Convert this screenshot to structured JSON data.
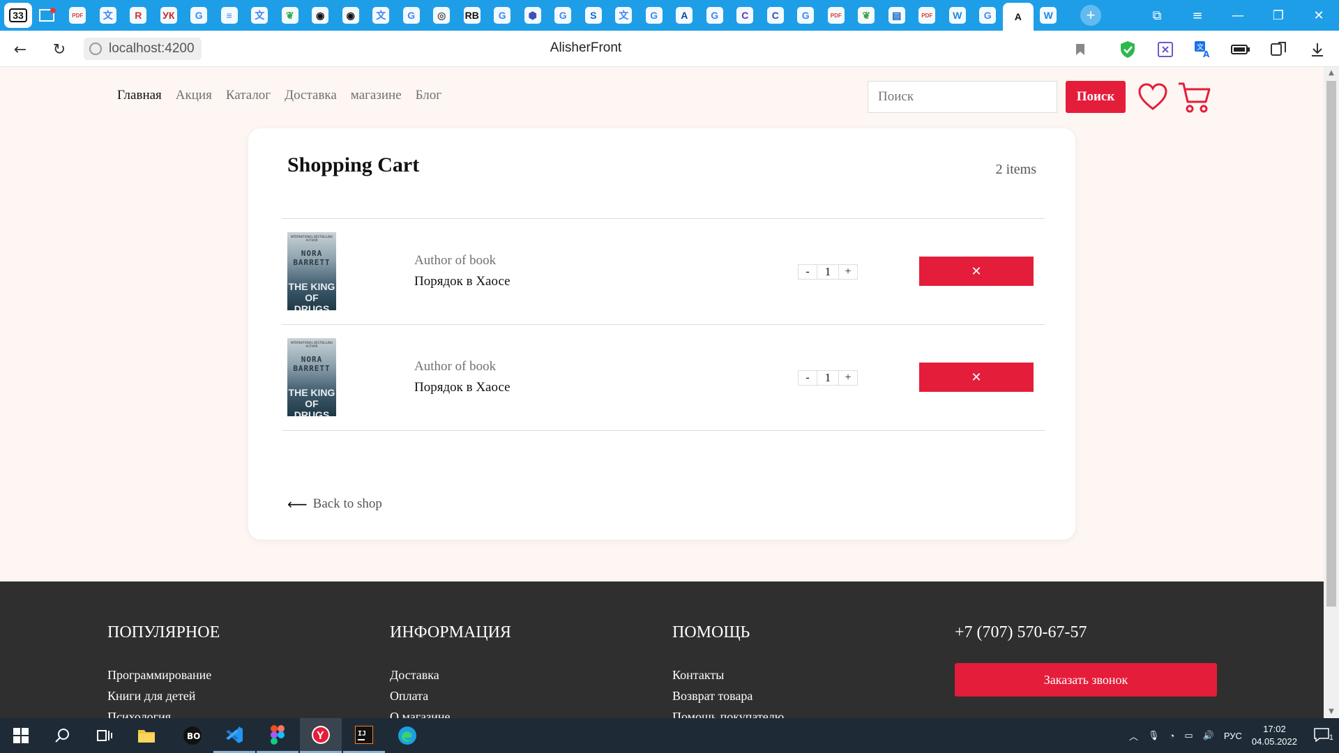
{
  "browser": {
    "tab_count": "33",
    "url": "localhost:4200",
    "page_title": "AlisherFront",
    "tabs": [
      {
        "icon": "pdf-icon",
        "color": "#e53935",
        "glyph": "PDF"
      },
      {
        "icon": "translate-icon",
        "color": "#4285f4",
        "glyph": "文"
      },
      {
        "icon": "bookmark-red-icon",
        "color": "#d32f2f",
        "glyph": "R"
      },
      {
        "icon": "uk-icon",
        "color": "#c62828",
        "glyph": "УК"
      },
      {
        "icon": "google-icon",
        "color": "#4285f4",
        "glyph": "G"
      },
      {
        "icon": "docs-icon",
        "color": "#4285f4",
        "glyph": "≡"
      },
      {
        "icon": "translate-icon",
        "color": "#4285f4",
        "glyph": "文"
      },
      {
        "icon": "leaf-icon",
        "color": "#34a853",
        "glyph": "❦"
      },
      {
        "icon": "github-icon",
        "color": "#111111",
        "glyph": "◉"
      },
      {
        "icon": "github-icon",
        "color": "#111111",
        "glyph": "◉"
      },
      {
        "icon": "translate-icon",
        "color": "#4285f4",
        "glyph": "文"
      },
      {
        "icon": "google-icon",
        "color": "#4285f4",
        "glyph": "G"
      },
      {
        "icon": "target-icon",
        "color": "#555555",
        "glyph": "◎"
      },
      {
        "icon": "rb-icon",
        "color": "#111111",
        "glyph": "RB"
      },
      {
        "icon": "google-icon",
        "color": "#4285f4",
        "glyph": "G"
      },
      {
        "icon": "hexagon-icon",
        "color": "#3f51b5",
        "glyph": "⬢"
      },
      {
        "icon": "google-icon",
        "color": "#4285f4",
        "glyph": "G"
      },
      {
        "icon": "stack-icon",
        "color": "#1565c0",
        "glyph": "S"
      },
      {
        "icon": "translate-icon",
        "color": "#4285f4",
        "glyph": "文"
      },
      {
        "icon": "google-icon",
        "color": "#4285f4",
        "glyph": "G"
      },
      {
        "icon": "azure-icon",
        "color": "#0d47a1",
        "glyph": "A"
      },
      {
        "icon": "google-icon",
        "color": "#4285f4",
        "glyph": "G"
      },
      {
        "icon": "c-icon",
        "color": "#5e35b1",
        "glyph": "C"
      },
      {
        "icon": "c-icon",
        "color": "#3949ab",
        "glyph": "C"
      },
      {
        "icon": "google-icon",
        "color": "#4285f4",
        "glyph": "G"
      },
      {
        "icon": "pdf-icon",
        "color": "#e53935",
        "glyph": "PDF"
      },
      {
        "icon": "leaf-icon",
        "color": "#43a047",
        "glyph": "❦"
      },
      {
        "icon": "doc-icon",
        "color": "#1565c0",
        "glyph": "▤"
      },
      {
        "icon": "pdf-icon",
        "color": "#e53935",
        "glyph": "PDF"
      },
      {
        "icon": "ww-icon",
        "color": "#1e88e5",
        "glyph": "W"
      },
      {
        "icon": "google-icon",
        "color": "#4285f4",
        "glyph": "G"
      },
      {
        "icon": "angular-icon",
        "color": "#111111",
        "glyph": "A",
        "active": true
      },
      {
        "icon": "ww-icon",
        "color": "#1e88e5",
        "glyph": "W"
      }
    ]
  },
  "nav": {
    "items": [
      "Главная",
      "Акция",
      "Каталог",
      "Доставка",
      "магазине",
      "Блог"
    ],
    "search_placeholder": "Поиск",
    "search_button": "Поиск"
  },
  "cart": {
    "title": "Shopping Cart",
    "count_label": "2 items",
    "items": [
      {
        "author": "Author of book",
        "title": "Порядок в Хаосе",
        "qty": "1",
        "cover": {
          "top": "INTERNATIONAL BESTSELLING AUTHOR",
          "author": "NORA BARRETT",
          "title": "THE KING OF DRUGS"
        }
      },
      {
        "author": "Author of book",
        "title": "Порядок в Хаосе",
        "qty": "1",
        "cover": {
          "top": "INTERNATIONAL BESTSELLING AUTHOR",
          "author": "NORA BARRETT",
          "title": "THE KING OF DRUGS"
        }
      }
    ],
    "minus": "-",
    "plus": "+",
    "remove": "✕",
    "back_label": "Back to shop",
    "back_arrow": "⟵"
  },
  "footer": {
    "columns": [
      {
        "heading": "ПОПУЛЯРНОЕ",
        "links": [
          "Программирование",
          "Книги для детей",
          "Психология"
        ]
      },
      {
        "heading": "ИНФОРМАЦИЯ",
        "links": [
          "Доставка",
          "Оплата",
          "О магазине"
        ]
      },
      {
        "heading": "ПОМОЩЬ",
        "links": [
          "Контакты",
          "Возврат товара",
          "Помощь покупателю"
        ]
      }
    ],
    "phone": "+7 (707) 570-67-57",
    "callback_button": "Заказать звонок"
  },
  "taskbar": {
    "language": "РУС",
    "time": "17:02",
    "date": "04.05.2022",
    "notifications": "1"
  },
  "colors": {
    "accent": "#e41d3a",
    "tabstrip": "#1f9ee8",
    "footer_bg": "#2f2f2f",
    "page_bg": "#fdf6f3"
  }
}
